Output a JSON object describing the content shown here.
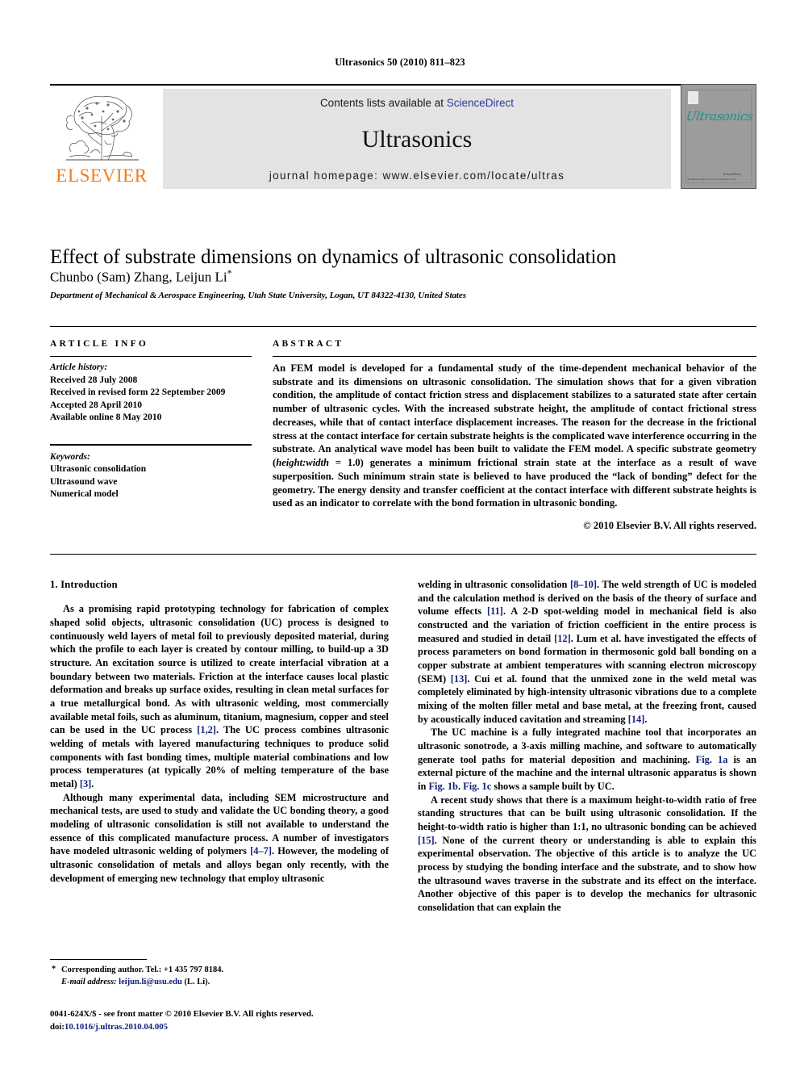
{
  "running_head": "Ultrasonics 50 (2010) 811–823",
  "masthead": {
    "publisher_name": "ELSEVIER",
    "publisher_logo_name": "elsevier-tree-logo",
    "contents_prefix": "Contents lists available at ",
    "contents_link": "ScienceDirect",
    "journal_name": "Ultrasonics",
    "homepage": "journal homepage: www.elsevier.com/locate/ultras",
    "cover": {
      "title": "Ultrasonics",
      "sciencedirect_mark": "ScienceDirect",
      "bottom_note": "Available online at www.sciencedirect.com"
    }
  },
  "article": {
    "title": "Effect of substrate dimensions on dynamics of ultrasonic consolidation",
    "authors": "Chunbo (Sam)  Zhang, Leijun Li",
    "corresponding_marker": "*",
    "affiliation": "Department of Mechanical & Aerospace Engineering, Utah State University, Logan, UT 84322-4130, United States"
  },
  "article_info": {
    "heading": "ARTICLE INFO",
    "history_label": "Article history:",
    "history": [
      "Received 28 July 2008",
      "Received in revised form 22 September 2009",
      "Accepted 28 April 2010",
      "Available online 8 May 2010"
    ],
    "keywords_label": "Keywords:",
    "keywords": [
      "Ultrasonic consolidation",
      "Ultrasound wave",
      "Numerical model"
    ]
  },
  "abstract": {
    "heading": "ABSTRACT",
    "part1": "An FEM model is developed for a fundamental study of the time-dependent mechanical behavior of the substrate and its dimensions on ultrasonic consolidation. The simulation shows that for a given vibration condition, the amplitude of contact friction stress and displacement stabilizes to a saturated state after certain number of ultrasonic cycles. With the increased substrate height, the amplitude of contact frictional stress decreases, while that of contact interface displacement increases. The reason for the decrease in the frictional stress at the contact interface for certain substrate heights is the complicated wave interference occurring in the substrate. An analytical wave model has been built to validate the FEM model. A specific substrate geometry (",
    "italic_term": "height:width",
    "part2": " = 1.0) generates a minimum frictional strain state at the interface as a result of wave superposition. Such minimum strain state is believed to have produced the “lack of bonding” defect for the geometry. The energy density and transfer coefficient at the contact interface with different substrate heights is used as an indicator to correlate with the bond formation in ultrasonic bonding.",
    "copyright": "© 2010 Elsevier B.V. All rights reserved."
  },
  "body": {
    "section_heading": "1. Introduction",
    "left_paragraphs": [
      {
        "chunks": [
          {
            "t": "As a promising rapid prototyping technology for fabrication of complex shaped solid objects, ultrasonic consolidation (UC) process is designed to continuously weld layers of metal foil to previously deposited material, during which the profile to each layer is created by contour milling, to build-up a 3D structure. An excitation source is utilized to create interfacial vibration at a boundary between two materials. Friction at the interface causes local plastic deformation and breaks up surface oxides, resulting in clean metal surfaces for a true metallurgical bond. As with ultrasonic welding, most commercially available metal foils, such as aluminum, titanium, magnesium, copper and steel can be used in the UC process "
          },
          {
            "t": "[1,2]",
            "ref": true
          },
          {
            "t": ". The UC process combines ultrasonic welding of metals with layered manufacturing techniques to produce solid components with fast bonding times, multiple material combinations and low process temperatures (at typically 20% of melting temperature of the base metal) "
          },
          {
            "t": "[3]",
            "ref": true
          },
          {
            "t": "."
          }
        ]
      },
      {
        "chunks": [
          {
            "t": "Although many experimental data, including SEM microstructure and mechanical tests, are used to study and validate the UC bonding theory, a good modeling of ultrasonic consolidation is still not available to understand the essence of this complicated manufacture process. A number of investigators have modeled ultrasonic welding of polymers "
          },
          {
            "t": "[4–7]",
            "ref": true
          },
          {
            "t": ". However, the modeling of ultrasonic consolidation of metals and alloys began only recently, with the development of emerging new technology that employ ultrasonic"
          }
        ]
      }
    ],
    "right_paragraphs": [
      {
        "no_indent": true,
        "chunks": [
          {
            "t": "welding in ultrasonic consolidation "
          },
          {
            "t": "[8–10]",
            "ref": true
          },
          {
            "t": ". The weld strength of UC is modeled and the calculation method is derived on the basis of the theory of surface and volume effects "
          },
          {
            "t": "[11]",
            "ref": true
          },
          {
            "t": ". A 2-D spot-welding model in mechanical field is also constructed and the variation of friction coefficient in the entire process is measured and studied in detail "
          },
          {
            "t": "[12]",
            "ref": true
          },
          {
            "t": ". Lum et al. have investigated the effects of process parameters on bond formation in thermosonic gold ball bonding on a copper substrate at ambient temperatures with scanning electron microscopy (SEM) "
          },
          {
            "t": "[13]",
            "ref": true
          },
          {
            "t": ". Cui et al. found that the unmixed zone in the weld metal was completely eliminated by high-intensity ultrasonic vibrations due to a complete mixing of the molten filler metal and base metal, at the freezing front, caused by acoustically induced cavitation and streaming "
          },
          {
            "t": "[14]",
            "ref": true
          },
          {
            "t": "."
          }
        ]
      },
      {
        "chunks": [
          {
            "t": "The UC machine is a fully integrated machine tool that incorporates an ultrasonic sonotrode, a 3-axis milling machine, and software to automatically generate tool paths for material deposition and machining. "
          },
          {
            "t": "Fig. 1a",
            "ref": true
          },
          {
            "t": " is an external picture of the machine and the internal ultrasonic apparatus is shown in "
          },
          {
            "t": "Fig. 1b",
            "ref": true
          },
          {
            "t": ". "
          },
          {
            "t": "Fig. 1c",
            "ref": true
          },
          {
            "t": " shows a sample built by UC."
          }
        ]
      },
      {
        "chunks": [
          {
            "t": "A recent study shows that there is a maximum height-to-width ratio of free standing structures that can be built using ultrasonic consolidation. If the height-to-width ratio is higher than 1:1, no ultrasonic bonding can be achieved "
          },
          {
            "t": "[15]",
            "ref": true
          },
          {
            "t": ". None of the current theory or understanding is able to explain this experimental observation. The objective of this article is to analyze the UC process by studying the bonding interface and the substrate, and to show how the ultrasound waves traverse in the substrate and its effect on the interface. Another objective of this paper is to develop the mechanics for ultrasonic consolidation that can explain the"
          }
        ]
      }
    ]
  },
  "footnotes": {
    "corresponding_marker": "*",
    "corresponding": "Corresponding author. Tel.: +1 435 797 8184.",
    "email_label": "E-mail address:",
    "email": "leijun.li@usu.edu",
    "email_owner": "(L. Li)."
  },
  "imprint": {
    "line1": "0041-624X/$ - see front matter © 2010 Elsevier B.V. All rights reserved.",
    "doi_label": "doi:",
    "doi": "10.1016/j.ultras.2010.04.005"
  },
  "colors": {
    "link": "#12207a",
    "elsevier_orange": "#F07D1A",
    "banner_bg": "#e3e3e3",
    "cover_teal": "#1f8f86"
  }
}
